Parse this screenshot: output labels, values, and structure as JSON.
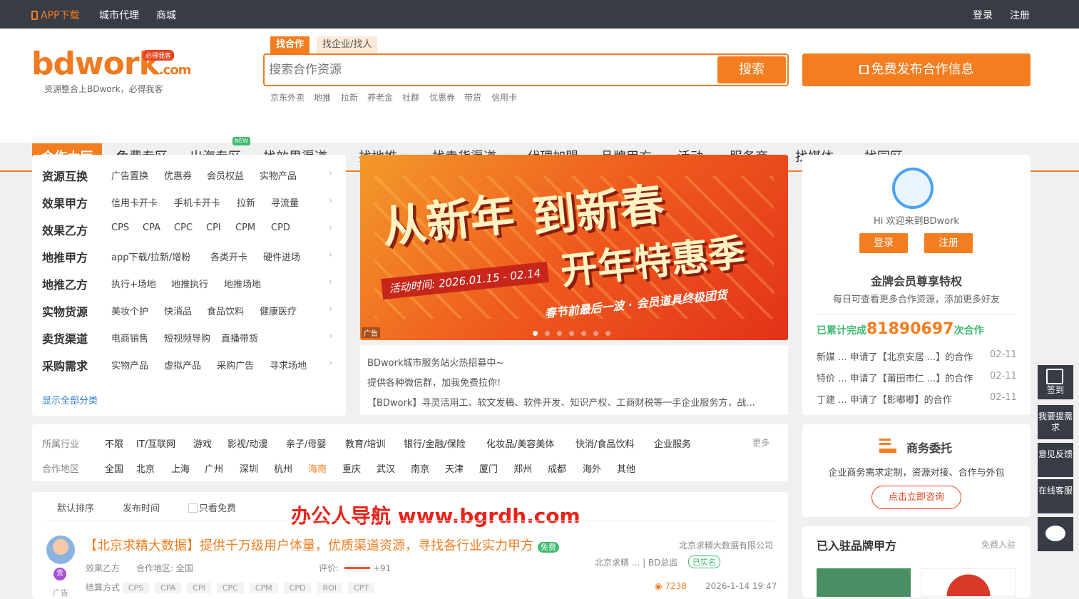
{
  "topbar": {
    "app": "APP下载",
    "city": "城市代理",
    "mall": "商城",
    "login": "登录",
    "register": "注册"
  },
  "logo": {
    "text": "bdwork",
    "suffix": ".com",
    "badge": "必得我客",
    "slogan": "资源整合上BDwork，必得我客"
  },
  "search": {
    "tab_active": "找合作",
    "tab_other": "找企业/找人",
    "placeholder": "搜索合作资源",
    "button": "搜索",
    "publish": "免费发布合作信息",
    "hot": [
      "京东外卖",
      "地推",
      "拉新",
      "养老金",
      "社群",
      "优惠券",
      "带货",
      "信用卡"
    ]
  },
  "nav": {
    "items": [
      "合作大厅",
      "免费专区",
      "出海专区",
      "找效果渠道",
      "找地推",
      "找卖货渠道",
      "代理加盟",
      "品牌甲方",
      "活动",
      "服务商",
      "找媒体",
      "找园区"
    ],
    "new_badge": "NEW"
  },
  "categories": [
    {
      "title": "资源互换",
      "subs": [
        "广告置换",
        "优惠券",
        "会员权益",
        "实物产品"
      ]
    },
    {
      "title": "效果甲方",
      "subs": [
        "信用卡开卡",
        "手机卡开卡",
        "拉新",
        "寻流量"
      ]
    },
    {
      "title": "效果乙方",
      "subs": [
        "CPS",
        "CPA",
        "CPC",
        "CPI",
        "CPM",
        "CPD"
      ]
    },
    {
      "title": "地推甲方",
      "subs": [
        "app下载/拉新/增粉",
        "各类开卡",
        "硬件进场"
      ]
    },
    {
      "title": "地推乙方",
      "subs": [
        "执行+场地",
        "地推执行",
        "地推场地"
      ]
    },
    {
      "title": "实物货源",
      "subs": [
        "美妆个护",
        "快消品",
        "食品饮料",
        "健康医疗"
      ]
    },
    {
      "title": "卖货渠道",
      "subs": [
        "电商销售",
        "短视频导购",
        "直播带货"
      ]
    },
    {
      "title": "采购需求",
      "subs": [
        "实物产品",
        "虚拟产品",
        "采购广告",
        "寻求场地"
      ]
    }
  ],
  "show_all": "显示全部分类",
  "banner": {
    "line1": "从新年",
    "line2": "到新春",
    "line3": "开年特惠季",
    "time": "活动时间: 2026.01.15 - 02.14",
    "sub": "春节前最后一波 · 会员道具终极团货",
    "ad": "广告"
  },
  "news": [
    "BDwork城市服务站火热招募中~",
    "提供各种微信群，加我免费拉你!",
    "【BDwork】寻灵活用工、软文发稿、软件开发、知识产权、工商财税等一手企业服务方，战..."
  ],
  "filter": {
    "industry_label": "所属行业",
    "industries": [
      "不限",
      "IT/互联网",
      "游戏",
      "影视/动漫",
      "亲子/母婴",
      "教育/培训",
      "银行/金融/保险",
      "化妆品/美容美体",
      "快消/食品饮料",
      "企业服务"
    ],
    "more": "更多",
    "region_label": "合作地区",
    "regions": [
      "全国",
      "北京",
      "上海",
      "广州",
      "深圳",
      "杭州",
      "海南",
      "重庆",
      "武汉",
      "南京",
      "天津",
      "厦门",
      "郑州",
      "成都",
      "海外",
      "其他"
    ]
  },
  "sort": {
    "default": "默认排序",
    "time": "发布时间",
    "free_only": "只看免费"
  },
  "watermark": "办公人导航  www.bgrdh.com",
  "listing": {
    "title": "【北京求精大数据】提供千万级用户体量，优质渠道资源，寻找各行业实力甲方",
    "free": "免费",
    "company": "北京求精大数据有限公司",
    "type": "效果乙方",
    "area": "合作地区: 全国",
    "rating_label": "评价:",
    "rating": "+91",
    "poster": "北京求精 ... | BD总监",
    "verified": "已实名",
    "settle_label": "结算方式",
    "settle": [
      "CPS",
      "CPA",
      "CPI",
      "CPC",
      "CPM",
      "CPD",
      "ROI",
      "CPT"
    ],
    "views": "7238",
    "date": "2026-1-14 19:47",
    "ad": "广告",
    "gong": "贡"
  },
  "user": {
    "welcome": "Hi 欢迎来到BDwork",
    "login": "登录",
    "register": "注册",
    "vip_title": "金牌会员尊享特权",
    "vip_sub": "每日可查看更多合作资源，添加更多好友",
    "completed_prefix": "已累计完成",
    "completed": "81890697",
    "completed_suffix": "次合作",
    "records": [
      {
        "text": "新媒 ... 申请了【北京安居 ...】的合作",
        "date": "02-11"
      },
      {
        "text": "特价 ... 申请了【莆田市仁 ...】的合作",
        "date": "02-11"
      },
      {
        "text": "丁建 ... 申请了【影嘟嘟】的合作",
        "date": "02-11"
      }
    ]
  },
  "biz": {
    "title": "商务委托",
    "sub": "企业商务需求定制，资源对接、合作与外包",
    "btn": "点击立即咨询"
  },
  "brand": {
    "title": "已入驻品牌甲方",
    "link": "免费入驻"
  },
  "tools": [
    "签到",
    "我要提需求",
    "意见反馈",
    "在线客服"
  ],
  "colors": {
    "accent": "#f47d20",
    "topbar": "#383c45"
  }
}
